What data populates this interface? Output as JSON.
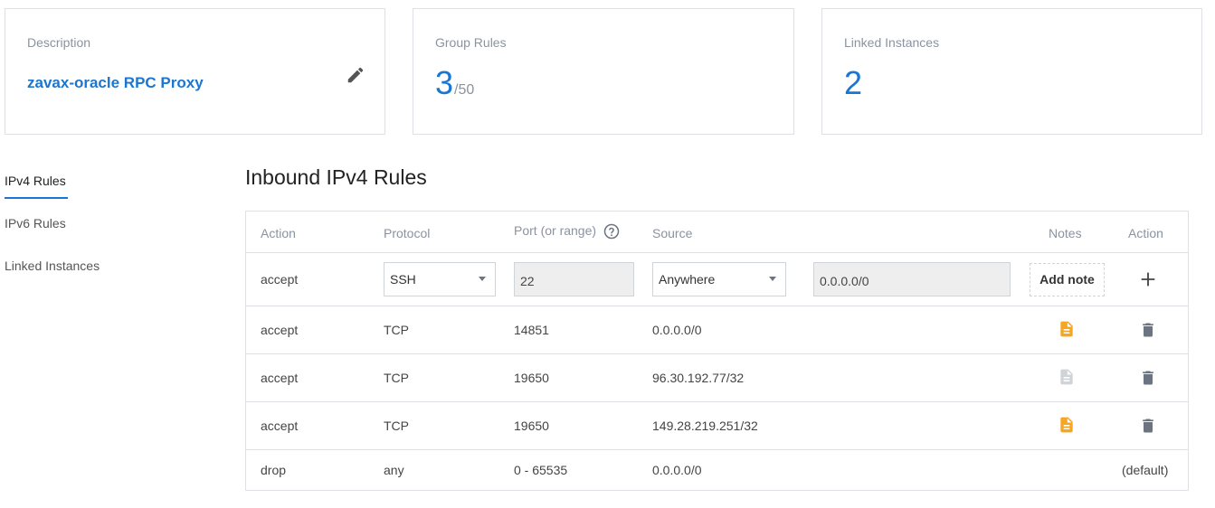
{
  "cards": {
    "description": {
      "label": "Description",
      "value": "zavax-oracle RPC Proxy"
    },
    "group_rules": {
      "label": "Group Rules",
      "count": "3",
      "max": "/50"
    },
    "linked_instances": {
      "label": "Linked Instances",
      "count": "2"
    }
  },
  "sidenav": {
    "items": [
      {
        "label": "IPv4 Rules",
        "active": true
      },
      {
        "label": "IPv6 Rules",
        "active": false
      },
      {
        "label": "Linked Instances",
        "active": false
      }
    ]
  },
  "heading": "Inbound IPv4 Rules",
  "table": {
    "headers": {
      "action": "Action",
      "protocol": "Protocol",
      "port": "Port (or range)",
      "source": "Source",
      "notes": "Notes",
      "action2": "Action"
    },
    "new_rule": {
      "action": "accept",
      "protocol": "SSH",
      "port": "22",
      "source": "Anywhere",
      "source_cidr": "0.0.0.0/0",
      "add_note_label": "Add note"
    },
    "rows": [
      {
        "action": "accept",
        "protocol": "TCP",
        "port": "14851",
        "source": "0.0.0.0/0",
        "has_note": true
      },
      {
        "action": "accept",
        "protocol": "TCP",
        "port": "19650",
        "source": "96.30.192.77/32",
        "has_note": false
      },
      {
        "action": "accept",
        "protocol": "TCP",
        "port": "19650",
        "source": "149.28.219.251/32",
        "has_note": true
      }
    ],
    "default_row": {
      "action": "drop",
      "protocol": "any",
      "port": "0 - 65535",
      "source": "0.0.0.0/0",
      "tag": "(default)"
    }
  },
  "colors": {
    "accent": "#1976d2",
    "note_active": "#f5a623",
    "note_inactive": "#d0d4d9",
    "icon_gray": "#6b7480"
  },
  "icons": {
    "edit": "pencil-icon",
    "help": "question-circle-icon",
    "add": "plus-icon",
    "note": "document-icon",
    "delete": "trash-icon"
  }
}
